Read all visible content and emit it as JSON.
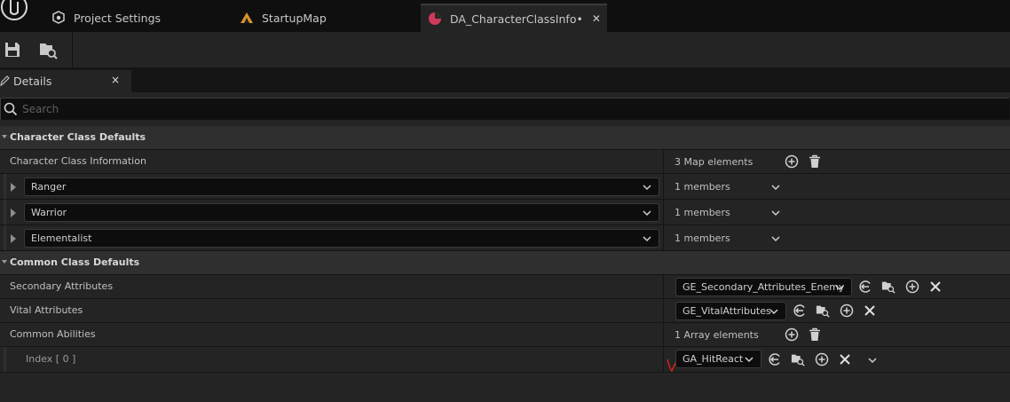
{
  "tabs": [
    {
      "label": "Project Settings",
      "icon": "gear-cube-icon"
    },
    {
      "label": "StartupMap",
      "icon": "level-map-icon"
    },
    {
      "label": "DA_CharacterClassInfo•",
      "icon": "data-asset-icon",
      "active": true
    }
  ],
  "toolbar": {
    "save_icon": "save-icon",
    "browse_icon": "browse-in-content-browser-icon"
  },
  "details": {
    "title": "Details",
    "close": "×"
  },
  "search": {
    "placeholder": "Search"
  },
  "sections": {
    "character_class_defaults": "Character Class Defaults",
    "common_class_defaults": "Common Class Defaults"
  },
  "character_class_information": {
    "label": "Character Class Information",
    "count": "3 Map elements",
    "entries": [
      {
        "key": "Ranger",
        "members": "1 members"
      },
      {
        "key": "Warrior",
        "members": "1 members"
      },
      {
        "key": "Elementalist",
        "members": "1 members"
      }
    ]
  },
  "secondary_attributes": {
    "label": "Secondary Attributes",
    "value": "GE_Secondary_Attributes_Enemy"
  },
  "vital_attributes": {
    "label": "Vital Attributes",
    "value": "GE_VitalAttributes"
  },
  "common_abilities": {
    "label": "Common Abilities",
    "count": "1 Array elements",
    "elements": [
      {
        "label": "Index [ 0 ]",
        "value": "GA_HitReact"
      }
    ]
  },
  "colors": {
    "accent_active_tab": "#d03a5a",
    "annotation": "#e02020"
  }
}
